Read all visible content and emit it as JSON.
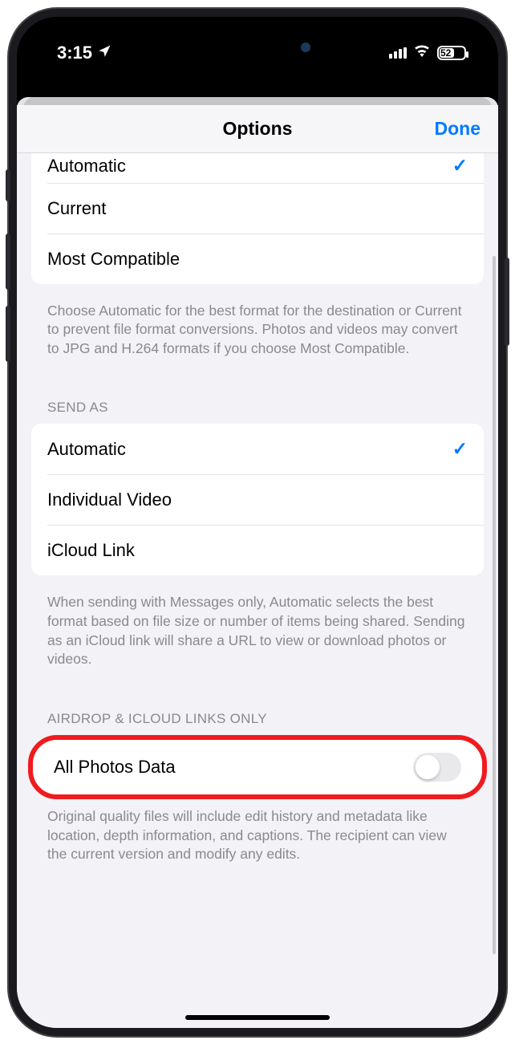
{
  "status": {
    "time": "3:15",
    "battery_pct": "52"
  },
  "nav": {
    "title": "Options",
    "done": "Done"
  },
  "format_group": {
    "row0": "Automatic",
    "row1": "Current",
    "row2": "Most Compatible",
    "footer": "Choose Automatic for the best format for the destination or Current to prevent file format conversions. Photos and videos may convert to JPG and H.264 formats if you choose Most Compatible."
  },
  "sendas": {
    "header": "SEND AS",
    "row0": "Automatic",
    "row1": "Individual Video",
    "row2": "iCloud Link",
    "footer": "When sending with Messages only, Automatic selects the best format based on file size or number of items being shared. Sending as an iCloud link will share a URL to view or download photos or videos."
  },
  "airdrop": {
    "header": "AIRDROP & ICLOUD LINKS ONLY",
    "row0": "All Photos Data",
    "footer": "Original quality files will include edit history and metadata like location, depth information, and captions. The recipient can view the current version and modify any edits."
  }
}
